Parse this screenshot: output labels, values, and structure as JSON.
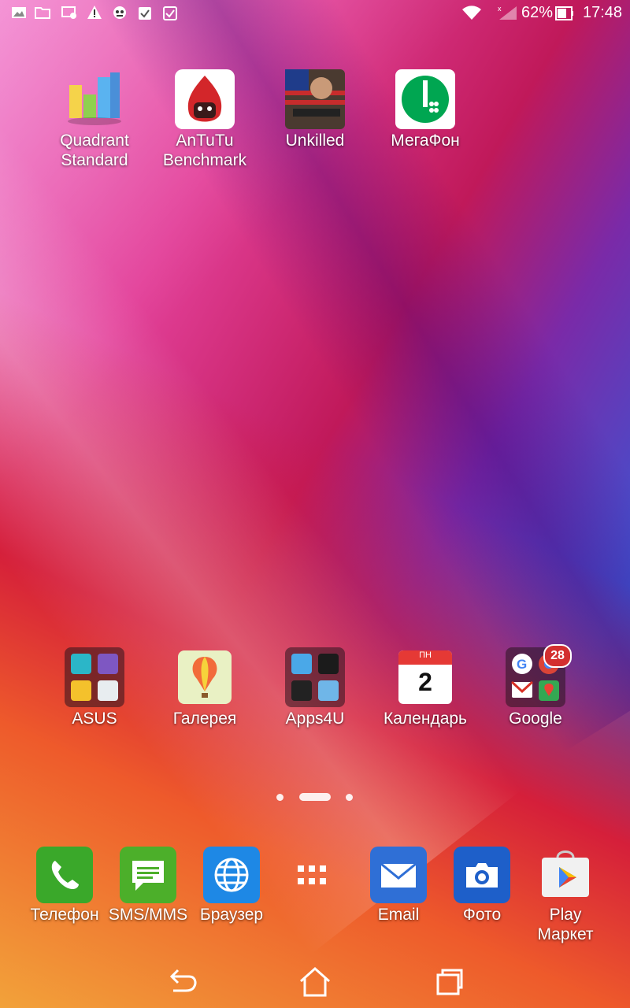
{
  "status_bar": {
    "battery": "62%",
    "time": "17:48",
    "notification_icons": [
      "image-icon",
      "folder-icon",
      "cast-icon",
      "warning-icon",
      "game-icon",
      "clipboard-check-icon",
      "clipboard-check-icon-2"
    ],
    "system_icons": [
      "wifi-icon",
      "signal-icon",
      "battery-icon"
    ]
  },
  "home": {
    "top_apps": [
      {
        "label": "Quadrant\nStandard",
        "icon": "quadrant-icon"
      },
      {
        "label": "AnTuTu\nBenchmark",
        "icon": "antutu-icon"
      },
      {
        "label": "Unkilled",
        "icon": "unkilled-icon"
      },
      {
        "label": "МегаФон",
        "icon": "megafon-icon"
      }
    ],
    "row_apps": [
      {
        "label": "ASUS",
        "icon": "asus-folder-icon"
      },
      {
        "label": "Галерея",
        "icon": "gallery-icon"
      },
      {
        "label": "Apps4U",
        "icon": "apps4u-folder-icon"
      },
      {
        "label": "Календарь",
        "icon": "calendar-icon",
        "calendar_day": "ПН",
        "calendar_date": "2"
      },
      {
        "label": "Google",
        "icon": "google-folder-icon",
        "badge": "28"
      }
    ],
    "page_indicator": {
      "pages": 3,
      "current": 2
    }
  },
  "dock": [
    {
      "label": "Телефон",
      "icon": "phone-icon"
    },
    {
      "label": "SMS/MMS",
      "icon": "sms-icon"
    },
    {
      "label": "Браузер",
      "icon": "browser-icon"
    },
    {
      "label": "",
      "icon": "app-drawer-icon"
    },
    {
      "label": "Email",
      "icon": "email-icon"
    },
    {
      "label": "Фото",
      "icon": "camera-icon"
    },
    {
      "label": "Play\nМаркет",
      "icon": "play-store-icon"
    }
  ],
  "nav": {
    "back": "back-icon",
    "home": "home-icon",
    "recents": "recents-icon"
  },
  "colors": {
    "phone": "#3aa82a",
    "sms": "#4caf2a",
    "browser": "#1e88e5",
    "email": "#2f6fd6",
    "camera": "#1e5fc9",
    "megafon": "#00a651"
  }
}
